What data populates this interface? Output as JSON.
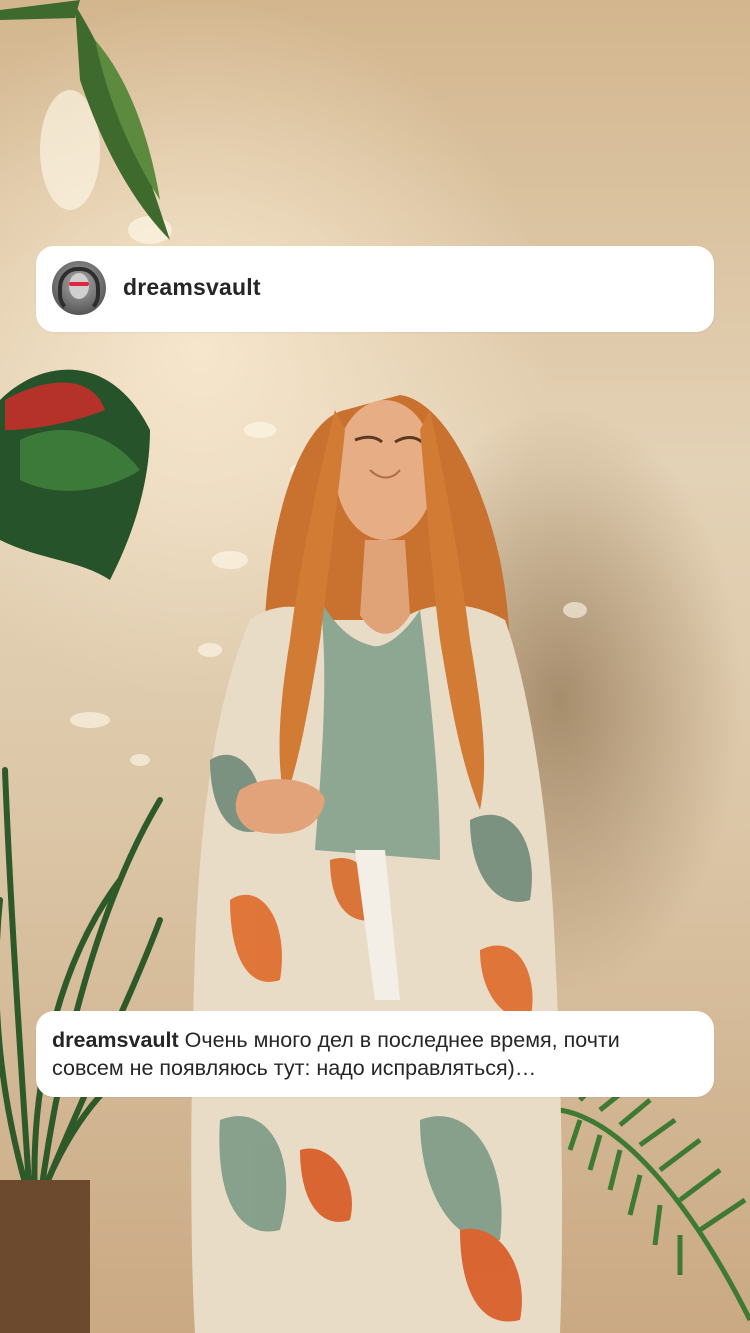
{
  "post": {
    "username": "dreamsvault",
    "caption_user": "dreamsvault",
    "caption_text": "Очень много дел в последнее время, почти совсем не появляюсь тут: надо исправляться)…"
  },
  "colors": {
    "card_bg": "#ffffff",
    "text": "#262626",
    "avatar_accent": "#e2263f"
  },
  "icons": {
    "avatar": "profile-avatar"
  }
}
